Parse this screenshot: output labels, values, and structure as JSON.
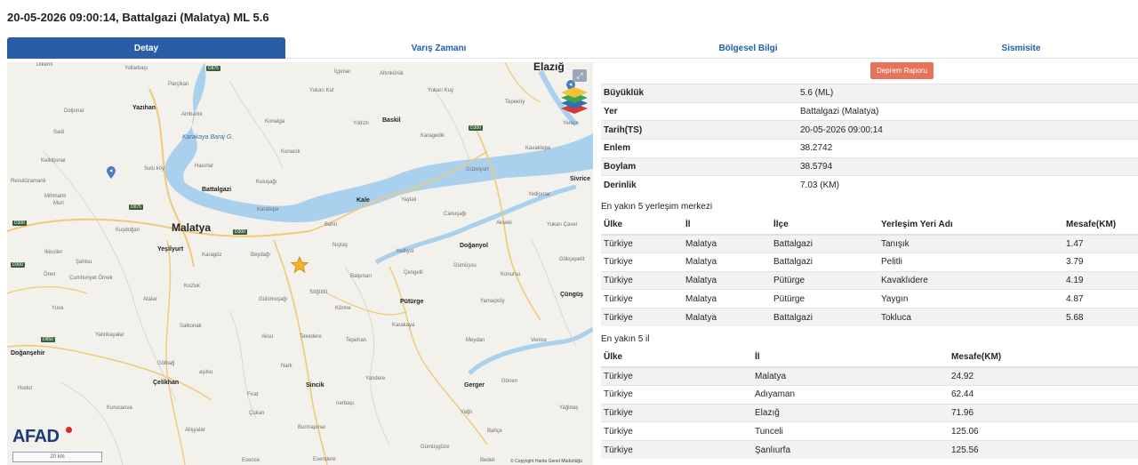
{
  "title": "20-05-2026 09:00:14, Battalgazi (Malatya) ML 5.6",
  "tabs": [
    "Detay",
    "Varış Zamanı",
    "Bölgesel Bilgi",
    "Sismisite"
  ],
  "map": {
    "labels": {
      "dikenli": "Dikenli",
      "yollarbasi": "Yollarbaşı",
      "icpinar": "İçpınar",
      "altinkuruk": "Altınkürük",
      "yukari_kul": "Yukarı Kul",
      "yukari_kuy": "Yukarı Kuy",
      "elazig": "Elazığ",
      "parcikan": "Parçikan",
      "dolpinar": "Dolpınar",
      "yazihan": "Yazıhan",
      "ambarlik": "Ambarlık",
      "konalga": "Konalga",
      "yildizli": "Yıldızlı",
      "baskil": "Baskil",
      "tepekoy": "Tepeköy",
      "yenice": "Yenice",
      "karakaya_baraj": "Karakaya Baraj G.",
      "sadi": "Sadi",
      "karagedik": "Karagedik",
      "kelkilpinar": "Kelkilpınar",
      "konacik": "Konacık",
      "hasirlar": "Hasırlar",
      "sulukoy": "Sulu köy",
      "kavaktepe": "Kavaktepe",
      "guzelyurt": "Güzelyurt",
      "resuluzamanli": "Resulüzamanlı",
      "kuluncak": "Kuluşağı",
      "sivrice": "Sivrice",
      "battalgazi": "Battalgazi",
      "kale": "Kale",
      "yaylali": "Yaylalı",
      "yedipinar": "Yedipınar",
      "mihmanli": "Mihmanlı",
      "muri": "Muri",
      "karatepe": "Karatepe",
      "canusagi": "Canuşağı",
      "malatya": "Malatya",
      "bahri": "Bahri",
      "akseki": "Akseki",
      "yukari_cavel": "Yukarı Çavel",
      "kusdogan": "Kuşdoğan",
      "yesilyurt": "Yeşilyurt",
      "nistas": "Nıştaş",
      "doganyol": "Doğanyol",
      "karagoz": "Karagöz",
      "beydagi": "Beydağı",
      "yedliyol": "Yedliyol",
      "gokcepelit": "Gökçepelit",
      "ikinciler": "İkinciler",
      "sahisu": "Şahisu",
      "gumussu": "Gümüşsu",
      "ören": "Ören",
      "cumhuriyet": "Cumhuriyet Örnek",
      "sogutlu": "Söğütlü",
      "balpinari": "Balpınarı",
      "cengelli": "Çengelli",
      "konursu": "Konursu",
      "cungus": "Çüngüş",
      "kozluk": "Kozluk",
      "yamackoy": "Yamaçköy",
      "korme": "Körme",
      "puturge": "Pütürge",
      "atalar": "Atalar",
      "gulumusagi": "Gülümuşağı",
      "yuva": "Yuva",
      "salkonak": "Salkonak",
      "karakaya": "Karakaya",
      "yalinkayalar": "Yalınkayalar",
      "aksu": "Aksu",
      "tekedere": "Tekedere",
      "tepehan": "Tepehan",
      "meydan": "Meydan",
      "venice": "Venice",
      "dogansehir": "Doğanşehir",
      "golbag": "Gölbağ",
      "narli": "Narlı",
      "yandere": "Yandere",
      "gonen": "Gönen",
      "celikhan": "Çelikhan",
      "sincik": "Sincik",
      "gerger": "Gerger",
      "yagli": "Yağlı",
      "hudut": "Hudut",
      "firat": "Fırat",
      "nerbasi": "nərbaşı",
      "kurucaova": "Kurucaova",
      "cukan": "Çukan",
      "yaglitaş": "Yağlıtaş",
      "burmapinar": "Burmapınar",
      "bahce": "Bahçe",
      "gumusgoze": "Gümüşgöze",
      "esence": "Esence",
      "esendere": "Esendere",
      "bedeli": "Bedeli",
      "alisyalar": "Alişyalar",
      "asilsu": "aşilsu"
    },
    "roads": [
      "D875",
      "D300",
      "D300",
      "D875",
      "D300",
      "D300",
      "D850"
    ],
    "logo": "AFAD",
    "scale": "20 km",
    "copyright": "© Copyright Harita Genel Müdürlüğü"
  },
  "report_button": "Deprem Raporu",
  "info": [
    {
      "key": "Büyüklük",
      "value": "5.6 (ML)"
    },
    {
      "key": "Yer",
      "value": "Battalgazi (Malatya)"
    },
    {
      "key": "Tarih(TS)",
      "value": "20-05-2026 09:00:14"
    },
    {
      "key": "Enlem",
      "value": "38.2742"
    },
    {
      "key": "Boylam",
      "value": "38.5794"
    },
    {
      "key": "Derinlik",
      "value": "7.03 (KM)"
    }
  ],
  "settlements": {
    "title": "En yakın 5 yerleşim merkezi",
    "headers": [
      "Ülke",
      "İl",
      "İlçe",
      "Yerleşim Yeri Adı",
      "Mesafe(KM)"
    ],
    "rows": [
      [
        "Türkiye",
        "Malatya",
        "Battalgazi",
        "Tanışık",
        "1.47"
      ],
      [
        "Türkiye",
        "Malatya",
        "Battalgazi",
        "Pelitli",
        "3.79"
      ],
      [
        "Türkiye",
        "Malatya",
        "Pütürge",
        "Kavaklıdere",
        "4.19"
      ],
      [
        "Türkiye",
        "Malatya",
        "Pütürge",
        "Yaygın",
        "4.87"
      ],
      [
        "Türkiye",
        "Malatya",
        "Battalgazi",
        "Tokluca",
        "5.68"
      ]
    ]
  },
  "provinces": {
    "title": "En yakın 5 il",
    "headers": [
      "Ülke",
      "İl",
      "Mesafe(KM)"
    ],
    "rows": [
      [
        "Türkiye",
        "Malatya",
        "24.92"
      ],
      [
        "Türkiye",
        "Adıyaman",
        "62.44"
      ],
      [
        "Türkiye",
        "Elazığ",
        "71.96"
      ],
      [
        "Türkiye",
        "Tunceli",
        "125.06"
      ],
      [
        "Türkiye",
        "Şanlıurfa",
        "125.56"
      ]
    ]
  },
  "colors": {
    "tab_active": "#2a5da8",
    "report_button": "#e6735c",
    "water": "#a9d0ec",
    "star": "#f0b429"
  }
}
